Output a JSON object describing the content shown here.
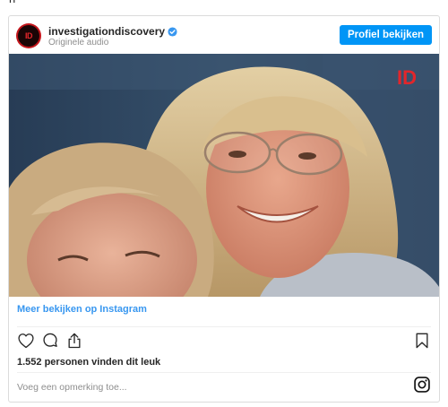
{
  "top_text": "n",
  "post": {
    "username": "investigationdiscovery",
    "subtitle": "Originele audio",
    "follow_button": "Profiel bekijken",
    "avatar_logo": "ID",
    "overlay_logo": "ID"
  },
  "footer": {
    "more_link": "Meer bekijken op Instagram",
    "likes": "1.552 personen vinden dit leuk",
    "comment_placeholder": "Voeg een opmerking toe..."
  },
  "icons": {
    "verified": "verified-badge-icon",
    "like": "heart-icon",
    "comment": "comment-icon",
    "share": "share-icon",
    "save": "bookmark-icon",
    "instagram": "instagram-icon"
  },
  "colors": {
    "button": "#0095f6",
    "link": "#3897f0",
    "brand_red": "#e2262b"
  }
}
